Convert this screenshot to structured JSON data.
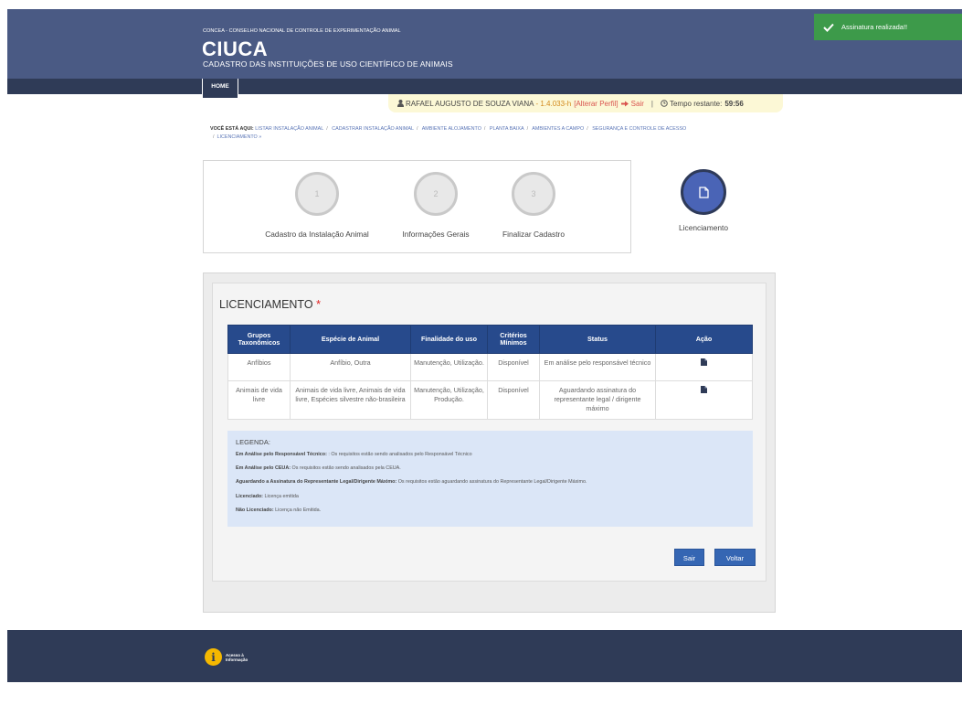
{
  "header": {
    "org": "CONCEA - CONSELHO NACIONAL DE CONTROLE DE EXPERIMENTAÇÃO ANIMAL",
    "logo": "CIUCA",
    "subtitle": "CADASTRO DAS INSTITUIÇÕES DE USO CIENTÍFICO DE ANIMAIS"
  },
  "nav": {
    "home": "HOME"
  },
  "toast": {
    "message": "Assinatura realizada!!",
    "color": "#3d9a4a"
  },
  "userbar": {
    "user": "RAFAEL AUGUSTO DE SOUZA VIANA",
    "version": "- 1.4.033-h",
    "change_profile": "[Alterar Perfil]",
    "logout": "Sair",
    "separator": "|",
    "timer_label": "Tempo restante:",
    "timer_value": "59:56"
  },
  "breadcrumb": {
    "label": "VOCÊ ESTÁ AQUI:",
    "items": [
      "LISTAR INSTALAÇÃO ANIMAL",
      "CADASTRAR INSTALAÇÃO ANIMAL",
      "AMBIENTE ALOJAMENTO",
      "PLANTA BAIXA",
      "AMBIENTES A CAMPO",
      "SEGURANÇA E CONTROLE DE ACESSO",
      "LICENCIAMENTO »"
    ]
  },
  "steps": [
    {
      "number": "1",
      "label": "Cadastro da Instalação Animal"
    },
    {
      "number": "2",
      "label": "Informações Gerais"
    },
    {
      "number": "3",
      "label": "Finalizar Cadastro"
    }
  ],
  "active_step": {
    "label": "Licenciamento",
    "icon": "document-icon",
    "color": "#4a64b6"
  },
  "section": {
    "title": "LICENCIAMENTO",
    "required_mark": "*"
  },
  "table": {
    "headers": [
      "Grupos Taxonômicos",
      "Espécie de Animal",
      "Finalidade do uso",
      "Critérios Mínimos",
      "Status",
      "Ação"
    ],
    "rows": [
      {
        "grupo": "Anfíbios",
        "especie": "Anfíbio, Outra",
        "finalidade": "Manutenção, Utilização.",
        "criterios": "Disponível",
        "status": "Em análise pelo responsável técnico",
        "acao_icon": "document-icon"
      },
      {
        "grupo": "Animais de vida livre",
        "especie": "Animais de vida livre, Animais de vida livre, Espécies silvestre não-brasileira",
        "finalidade": "Manutenção, Utilização, Produção.",
        "criterios": "Disponível",
        "status": "Aguardando assinatura do representante legal / dirigente máximo",
        "acao_icon": "document-icon"
      }
    ]
  },
  "legend": {
    "title": "LEGENDA:",
    "items": [
      {
        "term": "Em Análise pelo Responsável Técnico:",
        "desc": " : Os requisitos estão sendo analisados pelo Responsável Técnico"
      },
      {
        "term": "Em Análise pelo CEUA:",
        "desc": " Os requisitos estão sendo analisados pela CEUA."
      },
      {
        "term": "Aguardando a Assinatura do Representante Legal/Dirigente Máximo:",
        "desc": " Os requisitos estão aguardando assinatura do Representante Legal/Dirigente Máximo."
      },
      {
        "term": "Licenciado:",
        "desc": " Licença emitida"
      },
      {
        "term": "Não Licenciado:",
        "desc": " Licença não Emitida."
      }
    ]
  },
  "buttons": {
    "sair": "Sair",
    "voltar": "Voltar"
  },
  "footer": {
    "badge_line1": "Acesso à",
    "badge_line2": "Informação"
  }
}
